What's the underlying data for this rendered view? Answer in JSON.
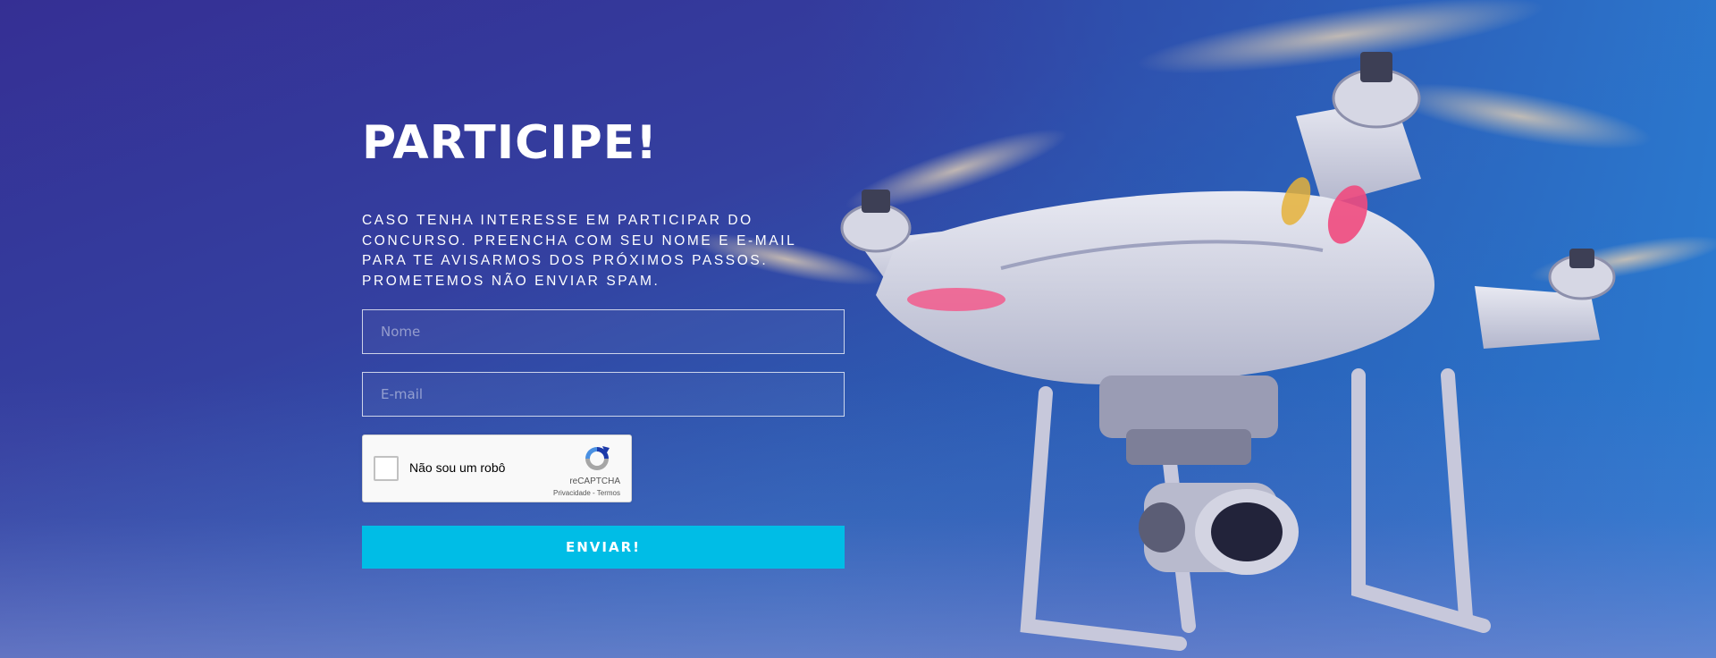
{
  "colors": {
    "background_left": "#352f94",
    "background_right": "#2f7ccc",
    "button": "#00bde6",
    "text": "#ffffff"
  },
  "hero": {
    "title": "PARTICIPE!",
    "intro": "CASO TENHA INTERESSE EM PARTICIPAR DO CONCURSO. PREENCHA COM SEU NOME E E-MAIL PARA TE AVISARMOS DOS PRÓXIMOS PASSOS. PROMETEMOS NÃO ENVIAR SPAM."
  },
  "form": {
    "name_placeholder": "Nome",
    "email_placeholder": "E-mail",
    "submit_label": "ENVIAR!"
  },
  "captcha": {
    "label": "Não sou um robô",
    "brand": "reCAPTCHA",
    "privacy": "Privacidade",
    "separator": " - ",
    "terms": "Termos",
    "icon": "recaptcha-logo-icon"
  },
  "background_image": {
    "subject": "drone-photo"
  }
}
